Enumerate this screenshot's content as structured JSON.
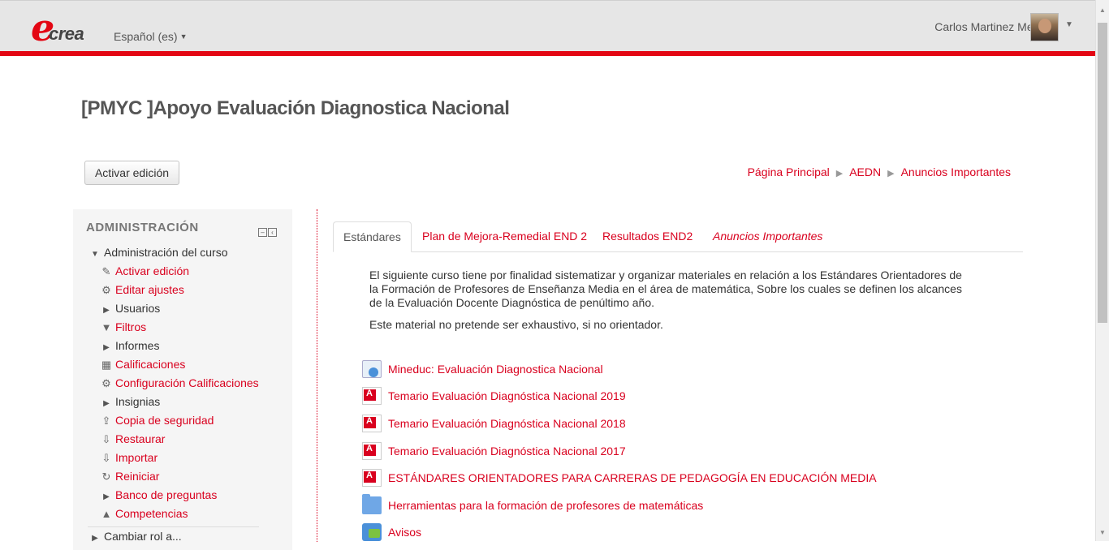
{
  "header": {
    "logo_e": "e",
    "logo_rest": "crea",
    "language": "Español (es)",
    "user_name": "Carlos Martinez Mendez"
  },
  "course": {
    "title": "[PMYC ]Apoyo Evaluación Diagnostica Nacional",
    "edit_button": "Activar edición"
  },
  "breadcrumb": [
    "Página Principal",
    "AEDN",
    "Anuncios Importantes"
  ],
  "admin_block": {
    "heading": "ADMINISTRACIÓN",
    "root": "Administración del curso",
    "items": [
      {
        "label": "Activar edición",
        "icon": "pencil-icon",
        "glyph": "✎",
        "link": true
      },
      {
        "label": "Editar ajustes",
        "icon": "gear-icon",
        "glyph": "⚙",
        "link": true
      },
      {
        "label": "Usuarios",
        "icon": "expand-arrow-icon",
        "glyph": "▶",
        "link": false
      },
      {
        "label": "Filtros",
        "icon": "filter-icon",
        "glyph": "▼",
        "link": true
      },
      {
        "label": "Informes",
        "icon": "expand-arrow-icon",
        "glyph": "▶",
        "link": false
      },
      {
        "label": "Calificaciones",
        "icon": "table-icon",
        "glyph": "▦",
        "link": true
      },
      {
        "label": "Configuración Calificaciones",
        "icon": "gear-icon",
        "glyph": "⚙",
        "link": true
      },
      {
        "label": "Insignias",
        "icon": "expand-arrow-icon",
        "glyph": "▶",
        "link": false
      },
      {
        "label": "Copia de seguridad",
        "icon": "upload-icon",
        "glyph": "⇪",
        "link": true
      },
      {
        "label": "Restaurar",
        "icon": "download-icon",
        "glyph": "⇩",
        "link": true
      },
      {
        "label": "Importar",
        "icon": "download-icon",
        "glyph": "⇩",
        "link": true
      },
      {
        "label": "Reiniciar",
        "icon": "refresh-icon",
        "glyph": "↻",
        "link": true
      },
      {
        "label": "Banco de preguntas",
        "icon": "expand-arrow-icon",
        "glyph": "▶",
        "link": true
      },
      {
        "label": "Competencias",
        "icon": "competencies-icon",
        "glyph": "▲",
        "link": true
      }
    ],
    "next_root": "Cambiar rol a..."
  },
  "tabs": [
    {
      "label": "Estándares",
      "active": true
    },
    {
      "label": "Plan de Mejora-Remedial END 2",
      "active": false
    },
    {
      "label": "Resultados END2",
      "active": false
    },
    {
      "label": "Anuncios Importantes",
      "active": false
    }
  ],
  "description": {
    "p1": "El siguiente curso tiene por finalidad sistematizar y organizar materiales en relación a los Estándares Orientadores de la Formación de Profesores de Enseñanza Media en el área de matemática, Sobre los cuales se definen los alcances de la Evaluación Docente Diagnóstica de penúltimo año.",
    "p2": "Este material no pretende ser exhaustivo, si no orientador."
  },
  "resources": [
    {
      "label": "Mineduc: Evaluación Diagnostica Nacional",
      "icon": "url-icon"
    },
    {
      "label": "Temario Evaluación Diagnóstica Nacional 2019",
      "icon": "pdf-icon"
    },
    {
      "label": "Temario Evaluación Diagnóstica Nacional 2018",
      "icon": "pdf-icon"
    },
    {
      "label": "Temario Evaluación Diagnóstica Nacional 2017",
      "icon": "pdf-icon"
    },
    {
      "label": "ESTÁNDARES ORIENTADORES PARA CARRERAS DE PEDAGOGÍA EN EDUCACIÓN MEDIA",
      "icon": "pdf-icon"
    },
    {
      "label": "Herramientas para la formación de profesores de matemáticas",
      "icon": "folder-icon"
    },
    {
      "label": "Avisos",
      "icon": "forum-icon"
    }
  ]
}
